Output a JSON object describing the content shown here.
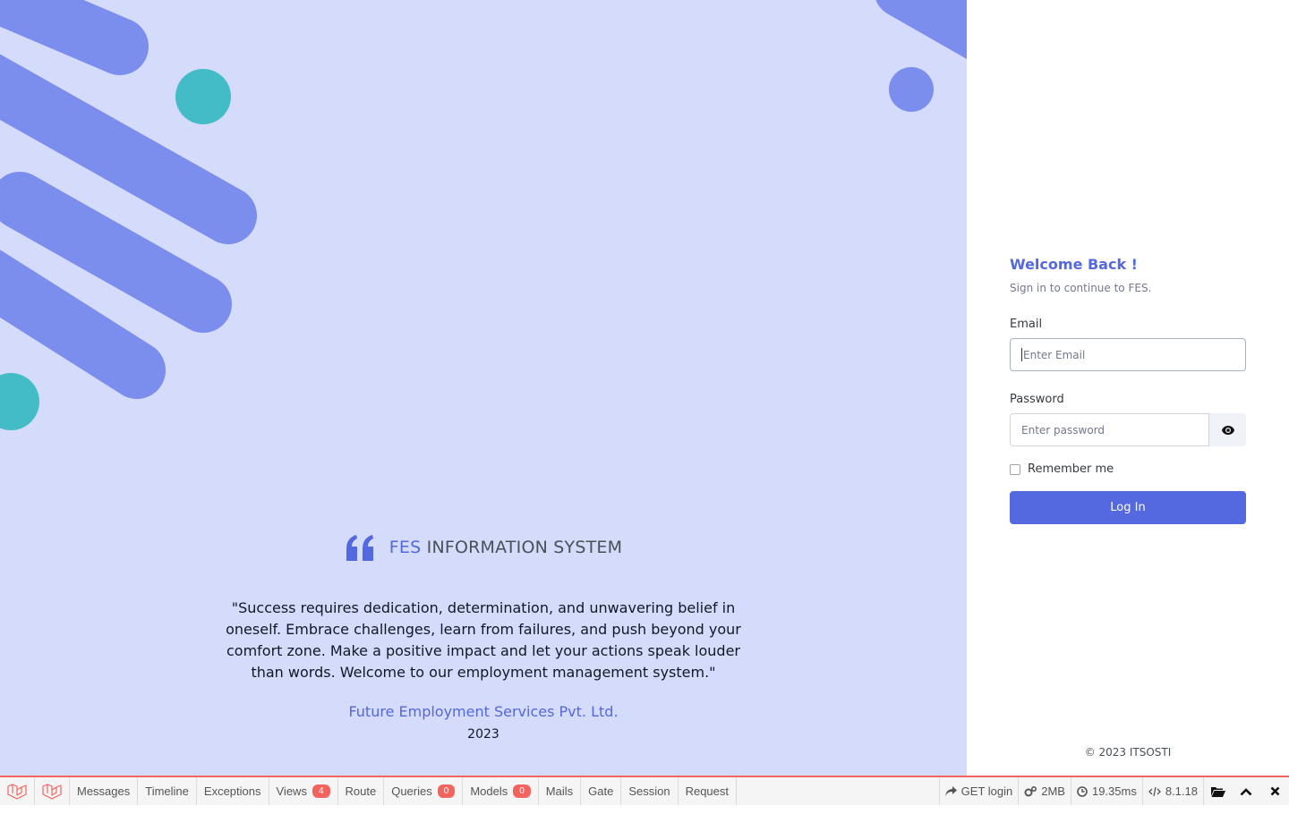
{
  "hero": {
    "brand_accent": "FES",
    "brand_rest": "INFORMATION SYSTEM",
    "quote": "\"Success requires dedication, determination, and unwavering belief in oneself. Embrace challenges, learn from failures, and push beyond your comfort zone. Make a positive impact and let your actions speak louder than words. Welcome to our employment management system.\"",
    "company": "Future Employment Services Pvt. Ltd.",
    "year": "2023"
  },
  "login": {
    "title": "Welcome Back !",
    "subtitle": "Sign in to continue to FES.",
    "email_label": "Email",
    "email_placeholder": "Enter Email",
    "password_label": "Password",
    "password_placeholder": "Enter password",
    "remember_label": "Remember me",
    "submit_label": "Log In",
    "copyright": "© 2023 ITSOSTI"
  },
  "debugbar": {
    "tabs": [
      {
        "label": "Messages"
      },
      {
        "label": "Timeline"
      },
      {
        "label": "Exceptions"
      },
      {
        "label": "Views",
        "badge": "4"
      },
      {
        "label": "Route"
      },
      {
        "label": "Queries",
        "badge": "0"
      },
      {
        "label": "Models",
        "badge": "0"
      },
      {
        "label": "Mails"
      },
      {
        "label": "Gate"
      },
      {
        "label": "Session"
      },
      {
        "label": "Request"
      }
    ],
    "request": "GET login",
    "memory": "2MB",
    "time": "19.35ms",
    "php_version": "8.1.18"
  },
  "colors": {
    "accent": "#5468df",
    "panel_bg": "#d5dbfa",
    "shape_blue": "#7b8ded",
    "shape_teal": "#44bcc8",
    "debug_red": "#f4645f"
  },
  "icons": {
    "quote": "quote-icon",
    "eye": "eye-icon",
    "laravel": "laravel-icon",
    "share": "share-icon",
    "cogs": "cogs-icon",
    "clock": "clock-icon",
    "code": "code-icon",
    "folder": "folder-open-icon",
    "chevron": "chevron-up-icon",
    "close": "close-icon"
  }
}
